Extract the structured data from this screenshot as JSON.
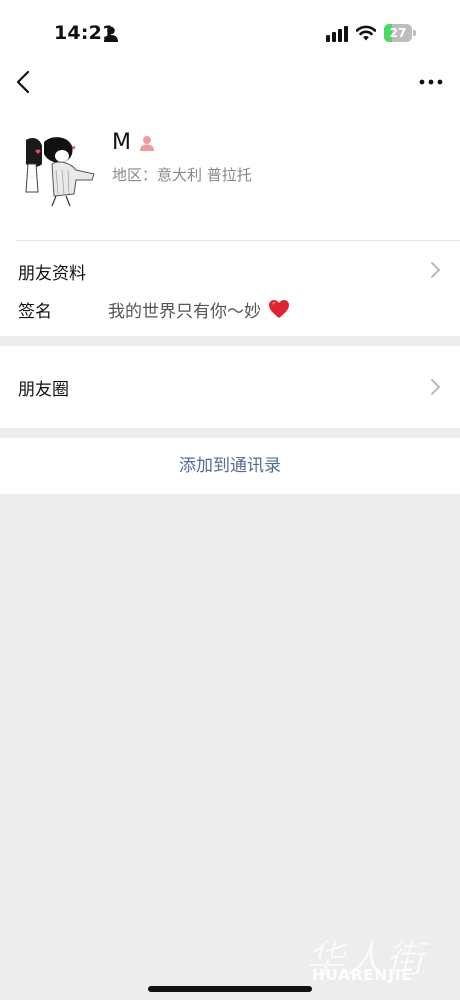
{
  "status_bar": {
    "time": "14:21",
    "battery_level": "27",
    "battery_fraction": 0.27,
    "icons": [
      "person-icon",
      "signal-icon",
      "wifi-icon",
      "battery-icon"
    ]
  },
  "nav": {
    "back_icon": "chevron-left-icon",
    "more_icon": "more-dots-icon"
  },
  "profile": {
    "name": "M",
    "gender_icon": "female-user-icon",
    "region": "地区：意大利 普拉托",
    "avatar": "anime-character-avatar"
  },
  "rows": {
    "profile_info_label": "朋友资料",
    "signature_label": "签名",
    "signature_value": "我的世界只有你～妙",
    "signature_emoji": "red-heart",
    "moments_label": "朋友圈"
  },
  "actions": {
    "add_to_contacts": "添加到通讯录"
  },
  "watermark": {
    "cn": "华人街",
    "en": "HUARENJIE"
  },
  "colors": {
    "link_blue": "#576b95",
    "background_gray": "#ededed",
    "battery_green": "#4cd964",
    "heart_red": "#e0242f"
  }
}
